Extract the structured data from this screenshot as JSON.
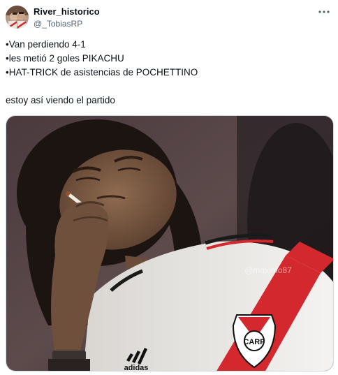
{
  "author": {
    "display_name": "River_historico",
    "handle": "@_TobiasRP"
  },
  "tweet": {
    "lines": [
      "•Van perdiendo 4-1",
      "•les metió 2 goles PIKACHU",
      "•HAT-TRICK de asistencias de POCHETTINO"
    ],
    "closing": "estoy así viendo el partido"
  },
  "media": {
    "watermark": "@maximo87",
    "shirt_text": "adidas",
    "crest_text": "CARP",
    "colors": {
      "shirt": "#f2f2f0",
      "sash": "#d2282e",
      "skin": "#7a5a43",
      "hair": "#1c1410"
    }
  },
  "icons": {
    "more": "more-horizontal-icon"
  }
}
